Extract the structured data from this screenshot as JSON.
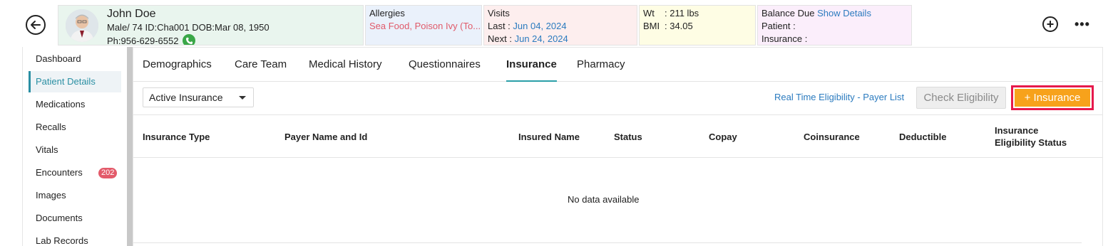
{
  "patient": {
    "name": "John Doe",
    "line2": "Male/ 74  ID:Cha001  DOB:Mar 08, 1950",
    "phone": "Ph:956-629-6552"
  },
  "allergies": {
    "title": "Allergies",
    "value": "Sea Food, Poison Ivy (To..."
  },
  "visits": {
    "title": "Visits",
    "last_label": "Last  :",
    "last_value": "Jun 04, 2024",
    "next_label": "Next :",
    "next_value": "Jun 24, 2024"
  },
  "vitals": {
    "wt_label": "Wt",
    "wt_value": ": 211 lbs",
    "bmi_label": "BMI",
    "bmi_value": ": 34.05"
  },
  "balance": {
    "title": "Balance Due",
    "link": "Show Details",
    "patient_label": "Patient :",
    "insurance_label": "Insurance :"
  },
  "header_actions": {
    "more": "•••"
  },
  "sidebar": {
    "items": [
      {
        "label": "Dashboard"
      },
      {
        "label": "Patient Details"
      },
      {
        "label": "Medications"
      },
      {
        "label": "Recalls"
      },
      {
        "label": "Vitals"
      },
      {
        "label": "Encounters",
        "badge": "202"
      },
      {
        "label": "Images"
      },
      {
        "label": "Documents"
      },
      {
        "label": "Lab Records"
      }
    ]
  },
  "tabs": [
    {
      "label": "Demographics"
    },
    {
      "label": "Care Team"
    },
    {
      "label": "Medical History"
    },
    {
      "label": "Questionnaires"
    },
    {
      "label": "Insurance"
    },
    {
      "label": "Pharmacy"
    }
  ],
  "toolbar": {
    "filter_value": "Active Insurance",
    "rte_link": "Real Time Eligibility - Payer List",
    "check_button": "Check Eligibility",
    "add_button": "+ Insurance"
  },
  "table": {
    "headers": [
      "Insurance Type",
      "Payer Name and Id",
      "Insured Name",
      "Status",
      "Copay",
      "Coinsurance",
      "Deductible",
      "Insurance Eligibility Status"
    ],
    "empty_text": "No data available"
  },
  "colors": {
    "accent": "#2a8fa3",
    "add_button": "#f7a21b",
    "highlight_border": "#e6194b",
    "badge": "#e35a6a"
  }
}
